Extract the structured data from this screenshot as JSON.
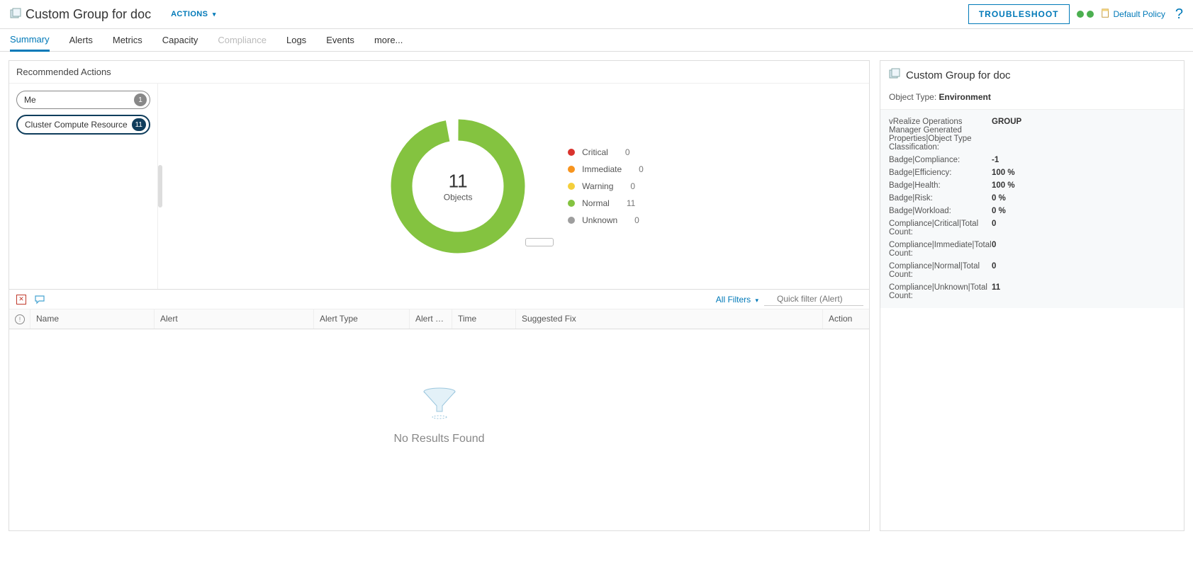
{
  "header": {
    "title": "Custom Group for doc",
    "actions_label": "ACTIONS",
    "troubleshoot": "TROUBLESHOOT",
    "policy": "Default Policy"
  },
  "tabs": {
    "summary": "Summary",
    "alerts": "Alerts",
    "metrics": "Metrics",
    "capacity": "Capacity",
    "compliance": "Compliance",
    "logs": "Logs",
    "events": "Events",
    "more": "more..."
  },
  "rec": {
    "panel_title": "Recommended Actions",
    "chips": [
      {
        "label": "Me",
        "count": "1"
      },
      {
        "label": "Cluster Compute Resource",
        "count": "11"
      }
    ]
  },
  "chart_data": {
    "type": "pie",
    "title": "",
    "center_value": "11",
    "center_label": "Objects",
    "series": [
      {
        "name": "Critical",
        "value": 0,
        "color": "#d9332d"
      },
      {
        "name": "Immediate",
        "value": 0,
        "color": "#f7941e"
      },
      {
        "name": "Warning",
        "value": 0,
        "color": "#f4cf3b"
      },
      {
        "name": "Normal",
        "value": 11,
        "color": "#84c340"
      },
      {
        "name": "Unknown",
        "value": 0,
        "color": "#9e9e9e"
      }
    ]
  },
  "alerts_panel": {
    "all_filters": "All Filters",
    "quick_placeholder": "Quick filter (Alert)",
    "columns": {
      "name": "Name",
      "alert": "Alert",
      "type": "Alert Type",
      "sub": "Alert Subt...",
      "time": "Time",
      "fix": "Suggested Fix",
      "action": "Action"
    },
    "no_results": "No Results Found"
  },
  "side": {
    "title": "Custom Group for doc",
    "object_type_label": "Object Type:",
    "object_type": "Environment",
    "props": [
      {
        "k": "vRealize Operations Manager Generated Properties|Object Type Classification:",
        "v": "GROUP"
      },
      {
        "k": "Badge|Compliance:",
        "v": "-1"
      },
      {
        "k": "Badge|Efficiency:",
        "v": "100 %"
      },
      {
        "k": "Badge|Health:",
        "v": "100 %"
      },
      {
        "k": "Badge|Risk:",
        "v": "0 %"
      },
      {
        "k": "Badge|Workload:",
        "v": "0 %"
      },
      {
        "k": "Compliance|Critical|Total Count:",
        "v": "0"
      },
      {
        "k": "Compliance|Immediate|Total Count:",
        "v": "0"
      },
      {
        "k": "Compliance|Normal|Total Count:",
        "v": "0"
      },
      {
        "k": "Compliance|Unknown|Total Count:",
        "v": "11"
      }
    ]
  }
}
